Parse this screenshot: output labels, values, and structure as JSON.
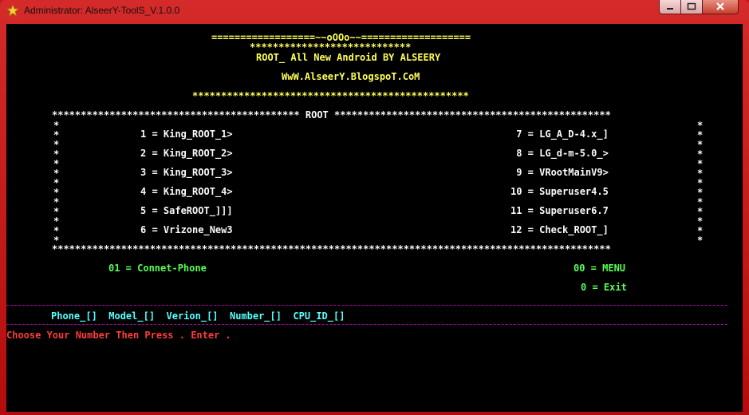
{
  "window": {
    "title": "Administrator: AlseerY-ToolS_V.1.0.0"
  },
  "header": {
    "line1": "==================~~oOOo~~===================",
    "line2": "****************************",
    "line3": "ROOT_ All New Android BY ALSEERY",
    "line4": "WwW.AlseerY.BlogspoT.CoM",
    "line5": "************************************************"
  },
  "box": {
    "top": "******************************************* ROOT ************************************************",
    "bottom": "*************************************************************************************************",
    "side": "*"
  },
  "left_options": [
    "1 = King_ROOT_1>",
    "2 = King_ROOT_2>",
    "3 = King_ROOT_3>",
    "4 = King_ROOT_4>",
    "5 = SafeROOT_]]]",
    "6 = Vrizone_New3"
  ],
  "right_options": [
    " 7 = LG_A_D-4.x_]",
    " 8 = LG_d-m-5.0_>",
    " 9 = VRootMainV9>",
    "10 = Superuser4.5",
    "11 = Superuser6.7",
    "12 = Check_ROOT_]"
  ],
  "menu": {
    "connect": "01 = Connet-Phone",
    "menu": "00 = MENU",
    "exit": "0 = Exit"
  },
  "info": "Phone_[]  Model_[]  Verion_[]  Number_[]  CPU_ID_[]",
  "prompt": "Choose Your Number Then Press . Enter ."
}
